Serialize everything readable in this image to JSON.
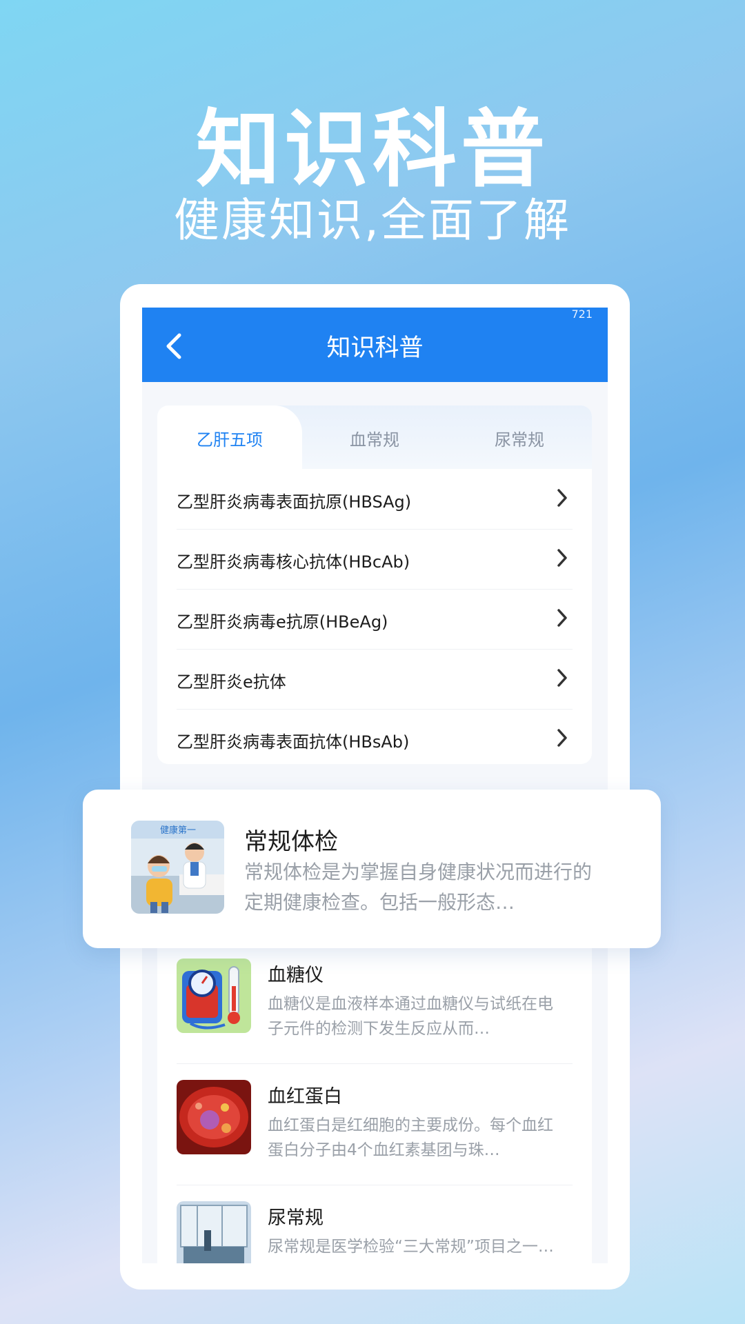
{
  "hero": {
    "title": "知识科普",
    "subtitle": "健康知识,全面了解"
  },
  "status_bar": {
    "number": "721"
  },
  "header": {
    "back_icon": "chevron-left-icon",
    "title": "知识科普"
  },
  "tabs": [
    {
      "label": "乙肝五项",
      "active": true
    },
    {
      "label": "血常规",
      "active": false
    },
    {
      "label": "尿常规",
      "active": false
    }
  ],
  "list": [
    {
      "label": "乙型肝炎病毒表面抗原(HBSAg)"
    },
    {
      "label": "乙型肝炎病毒核心抗体(HBcAb)"
    },
    {
      "label": "乙型肝炎病毒e抗原(HBeAg)"
    },
    {
      "label": "乙型肝炎e抗体"
    },
    {
      "label": "乙型肝炎病毒表面抗体(HBsAb)"
    }
  ],
  "featured": {
    "title": "常规体检",
    "description": "常规体检是为掌握自身健康状况而进行的定期健康检查。包括一般形态…",
    "thumb_text": "健康第一"
  },
  "articles": [
    {
      "title": "血糖仪",
      "description": "血糖仪是血液样本通过血糖仪与试纸在电子元件的检测下发生反应从而…"
    },
    {
      "title": "血红蛋白",
      "description": "血红蛋白是红细胞的主要成份。每个血红蛋白分子由4个血红素基团与珠…"
    },
    {
      "title": "尿常规",
      "description": "尿常规是医学检验“三大常规”项目之一…"
    }
  ],
  "colors": {
    "primary": "#1f82f2",
    "text": "#1c1c1c",
    "muted": "#9aa0a8"
  }
}
